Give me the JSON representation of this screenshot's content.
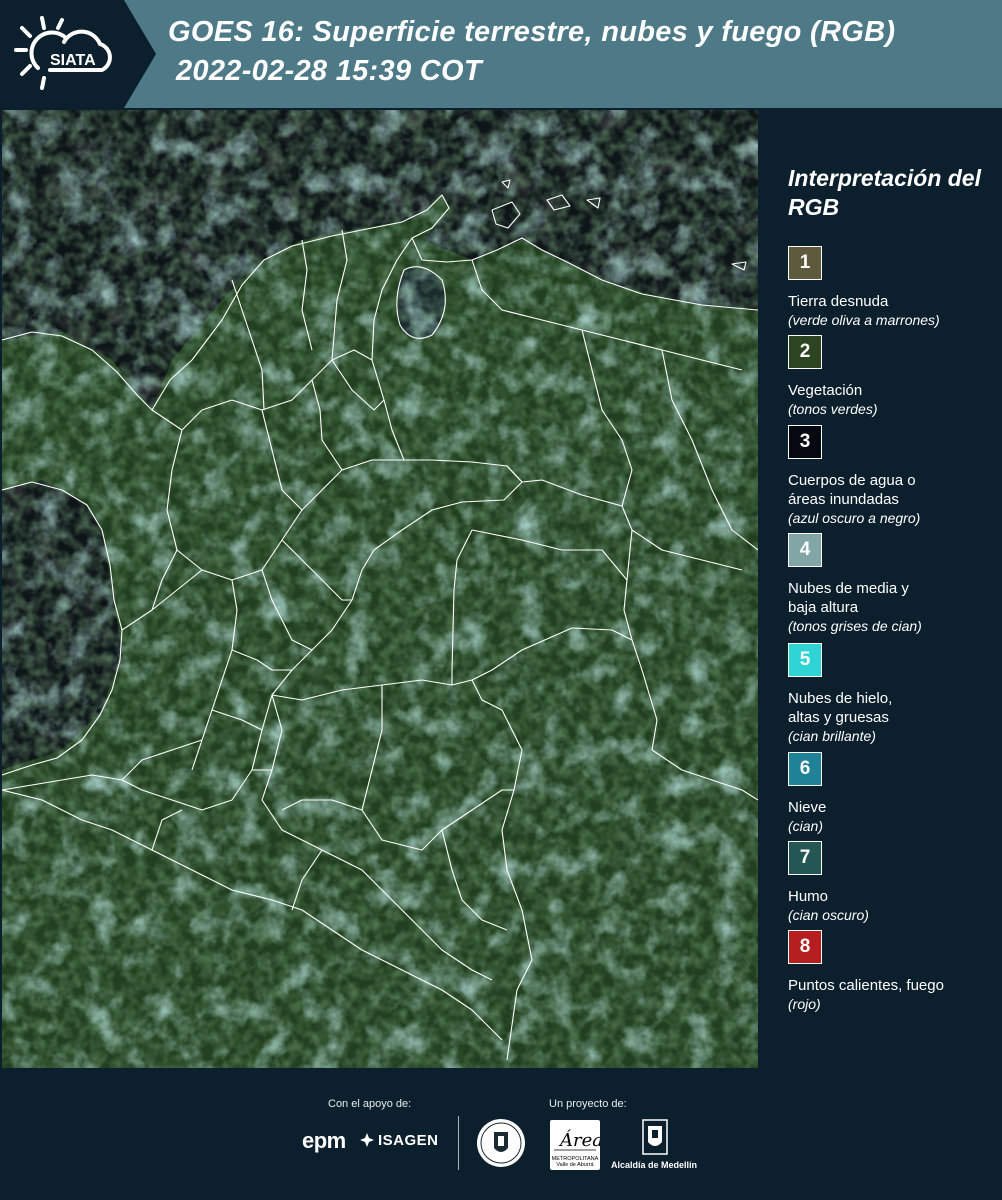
{
  "header": {
    "brand": "SIATA",
    "title_line1": "GOES 16: Superficie terrestre, nubes y fuego (RGB)",
    "title_line2": "2022-02-28 15:39 COT"
  },
  "legend": {
    "title": "Interpretación del RGB",
    "items": [
      {
        "num": "1",
        "label": "Tierra desnuda",
        "desc": "(verde oliva a marrones)",
        "color": "#5d5a3e"
      },
      {
        "num": "2",
        "label": "Vegetación",
        "desc": "(tonos verdes)",
        "color": "#2c4420"
      },
      {
        "num": "3",
        "label": "Cuerpos de agua o áreas inundadas",
        "desc": "(azul oscuro a negro)",
        "color": "#060a10"
      },
      {
        "num": "4",
        "label": "Nubes de media y baja altura",
        "desc": "(tonos grises de cian)",
        "color": "#82a6a6"
      },
      {
        "num": "5",
        "label": "Nubes de hielo, altas y gruesas",
        "desc": "(cian brillante)",
        "color": "#2fd4d4"
      },
      {
        "num": "6",
        "label": "Nieve",
        "desc": "(cian)",
        "color": "#1f8296"
      },
      {
        "num": "7",
        "label": "Humo",
        "desc": "(cian oscuro)",
        "color": "#245654"
      },
      {
        "num": "8",
        "label": "Puntos calientes, fuego",
        "desc": "(rojo)",
        "color": "#b51e1e"
      }
    ]
  },
  "footer": {
    "support_label": "Con el apoyo de:",
    "project_label": "Un proyecto de:",
    "sponsors": [
      "epm",
      "ISAGEN"
    ],
    "partners": {
      "amva": "METROPOLITANA Valle de Aburrá",
      "amva_script": "Área",
      "medellin": "Alcaldía de Medellín"
    }
  },
  "colors": {
    "header_bg": "#4e7a88",
    "panel_bg": "#0c1f2c",
    "ocean": "#0d1316",
    "land": "#1f3a20",
    "cloud": "#7cc6c6",
    "border": "#ffffff"
  }
}
